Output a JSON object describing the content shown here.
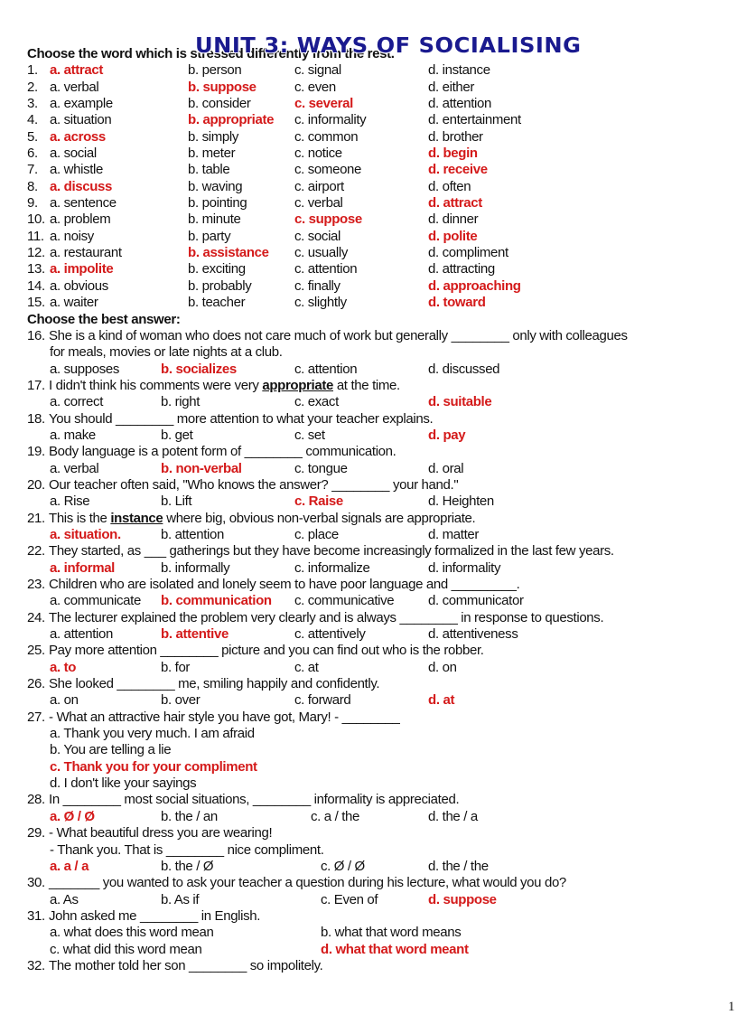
{
  "title": "UNIT 3: WAYS OF SOCIALISING",
  "section1": {
    "heading": "Choose the word which is stressed differently from the rest.",
    "items": [
      {
        "num": "1.",
        "options": [
          "a. attract",
          "b. person",
          "c. signal",
          "d. instance"
        ],
        "answer": 0
      },
      {
        "num": "2.",
        "options": [
          "a. verbal",
          "b. suppose",
          "c. even",
          "d. either"
        ],
        "answer": 1
      },
      {
        "num": "3.",
        "options": [
          "a. example",
          "b. consider",
          "c. several",
          "d. attention"
        ],
        "answer": 2
      },
      {
        "num": "4.",
        "options": [
          "a. situation",
          "b. appropriate",
          "c. informality",
          "d. entertainment"
        ],
        "answer": 1
      },
      {
        "num": "5.",
        "options": [
          "a. across",
          "b. simply",
          "c. common",
          "d. brother"
        ],
        "answer": 0
      },
      {
        "num": "6.",
        "options": [
          "a. social",
          "b. meter",
          "c. notice",
          "d. begin"
        ],
        "answer": 3
      },
      {
        "num": "7.",
        "options": [
          "a. whistle",
          "b. table",
          "c. someone",
          "d. receive"
        ],
        "answer": 3
      },
      {
        "num": "8.",
        "options": [
          "a. discuss",
          "b. waving",
          "c. airport",
          "d. often"
        ],
        "answer": 0
      },
      {
        "num": "9.",
        "options": [
          "a. sentence",
          "b. pointing",
          "c. verbal",
          "d. attract"
        ],
        "answer": 3
      },
      {
        "num": "10.",
        "options": [
          "a. problem",
          "b. minute",
          "c. suppose",
          "d. dinner"
        ],
        "answer": 2
      },
      {
        "num": "11.",
        "options": [
          "a. noisy",
          "b. party",
          "c. social",
          "d. polite"
        ],
        "answer": 3
      },
      {
        "num": "12.",
        "options": [
          "a. restaurant",
          "b. assistance",
          "c. usually",
          "d. compliment"
        ],
        "answer": 1
      },
      {
        "num": "13.",
        "options": [
          "a. impolite",
          "b. exciting",
          "c. attention",
          "d. attracting"
        ],
        "answer": 0
      },
      {
        "num": "14.",
        "options": [
          "a. obvious",
          "b. probably",
          "c. finally",
          "d. approaching"
        ],
        "answer": 3
      },
      {
        "num": "15.",
        "options": [
          "a. waiter",
          "b. teacher",
          "c. slightly",
          "d. toward"
        ],
        "answer": 3
      }
    ]
  },
  "section2": {
    "heading": "Choose the best answer:",
    "items": [
      {
        "num": "16.",
        "stem": [
          [
            {
              "t": "She is a kind of woman who does not care much of work but generally ________ only with colleagues"
            }
          ],
          [
            {
              "t": "for meals, movies or late nights at a club."
            }
          ]
        ],
        "options": [
          [
            "a. supposes",
            "b. socializes",
            "c. attention",
            "d. discussed"
          ]
        ],
        "answer": "b. socializes"
      },
      {
        "num": "17.",
        "stem": [
          [
            {
              "t": "I didn't think his comments were very "
            },
            {
              "t": "appropriate",
              "u": true
            },
            {
              "t": " at the time."
            }
          ]
        ],
        "options": [
          [
            "a. correct",
            "b. right",
            "c. exact",
            "d. suitable"
          ]
        ],
        "answer": "d. suitable"
      },
      {
        "num": "18.",
        "stem": [
          [
            {
              "t": "You should ________ more attention to what your teacher explains."
            }
          ]
        ],
        "options": [
          [
            "a. make",
            "b. get",
            "c. set",
            "d. pay"
          ]
        ],
        "answer": "d. pay"
      },
      {
        "num": "19.",
        "stem": [
          [
            {
              "t": "Body language is a potent form of ________ communication."
            }
          ]
        ],
        "options": [
          [
            "a. verbal",
            "b. non-verbal",
            "c. tongue",
            "d. oral"
          ]
        ],
        "answer": "b. non-verbal"
      },
      {
        "num": "20.",
        "stem": [
          [
            {
              "t": "Our teacher often said, \"Who knows the answer? ________ your hand.\""
            }
          ]
        ],
        "options": [
          [
            "a. Rise",
            "b. Lift",
            "c. Raise",
            "d. Heighten"
          ]
        ],
        "answer": "c. Raise"
      },
      {
        "num": "21.",
        "stem": [
          [
            {
              "t": "This is the "
            },
            {
              "t": "instance",
              "u": true
            },
            {
              "t": " where big, obvious non-verbal signals are appropriate."
            }
          ]
        ],
        "options": [
          [
            "a. situation.",
            "b. attention",
            "c. place",
            "d. matter"
          ]
        ],
        "answer": "a. situation."
      },
      {
        "num": "22.",
        "stem": [
          [
            {
              "t": "They started, as ___ gatherings but they have become increasingly formalized in the last few years."
            }
          ]
        ],
        "options": [
          [
            "a. informal",
            "b. informally",
            "c. informalize",
            "d. informality"
          ]
        ],
        "answer": "a. informal"
      },
      {
        "num": "23.",
        "stem": [
          [
            {
              "t": "Children who are isolated and lonely seem to have poor language and _________."
            }
          ]
        ],
        "options": [
          [
            "a. communicate",
            "b. communication",
            "c. communicative",
            "d. communicator"
          ]
        ],
        "answer": "b. communication"
      },
      {
        "num": "24.",
        "stem": [
          [
            {
              "t": "The lecturer explained the problem very clearly and is always ________ in response to questions."
            }
          ]
        ],
        "options": [
          [
            "a. attention",
            "b. attentive",
            "c. attentively",
            "d. attentiveness"
          ]
        ],
        "answer": "b. attentive"
      },
      {
        "num": "25.",
        "stem": [
          [
            {
              "t": "Pay more attention ________ picture and you can find out who is the robber."
            }
          ]
        ],
        "options": [
          [
            "a. to",
            "b. for",
            "c. at",
            "d. on"
          ]
        ],
        "answer": "a. to"
      },
      {
        "num": "26.",
        "stem": [
          [
            {
              "t": "She looked ________ me, smiling happily and confidently."
            }
          ]
        ],
        "options": [
          [
            "a. on",
            "b. over",
            "c. forward",
            "d. at"
          ]
        ],
        "answer": "d. at"
      },
      {
        "num": "27.",
        "stem": [
          [
            {
              "t": "- What an attractive hair style you have got, Mary!      - ________"
            }
          ]
        ],
        "options": [
          [
            "a. Thank you very much. I am afraid"
          ],
          [
            "b. You are telling a lie"
          ],
          [
            "c. Thank you for your compliment"
          ],
          [
            "d. I don't like your sayings"
          ]
        ],
        "answer": "c. Thank you for your compliment"
      },
      {
        "num": "28.",
        "stem": [
          [
            {
              "t": "In ________ most social situations, ________ informality is appreciated."
            }
          ]
        ],
        "options": [
          [
            "a. Ø / Ø",
            "b. the / an",
            "c. a / the",
            "d. the / a"
          ]
        ],
        "answer": "a. Ø / Ø"
      },
      {
        "num": "29.",
        "stem": [
          [
            {
              "t": "- What beautiful dress you are wearing!"
            }
          ],
          [
            {
              "t": "- Thank you. That is ________ nice compliment."
            }
          ]
        ],
        "options": [
          [
            "a. a / a",
            "b. the / Ø",
            "c. Ø / Ø",
            "d. the / the"
          ]
        ],
        "answer": "a. a / a"
      },
      {
        "num": "30.",
        "stem": [
          [
            {
              "t": "_______ you wanted to ask your teacher a question during his lecture, what would you do?"
            }
          ]
        ],
        "options": [
          [
            "a. As",
            "b. As if",
            "c. Even of",
            "d. suppose"
          ]
        ],
        "answer": "d. suppose"
      },
      {
        "num": "31.",
        "stem": [
          [
            {
              "t": "John asked me ________ in English."
            }
          ]
        ],
        "options": [
          [
            "a. what does this word mean",
            "b. what that word means"
          ],
          [
            "c. what did this word mean",
            "d. what that word meant"
          ]
        ],
        "answer": "d. what that word meant"
      },
      {
        "num": "32.",
        "stem": [
          [
            {
              "t": "The mother told her son ________ so impolitely."
            }
          ]
        ],
        "options": [],
        "answer": ""
      }
    ]
  },
  "page_number": "1",
  "colors": {
    "answer": "#d41a1a",
    "title": "#1a1a8f"
  }
}
